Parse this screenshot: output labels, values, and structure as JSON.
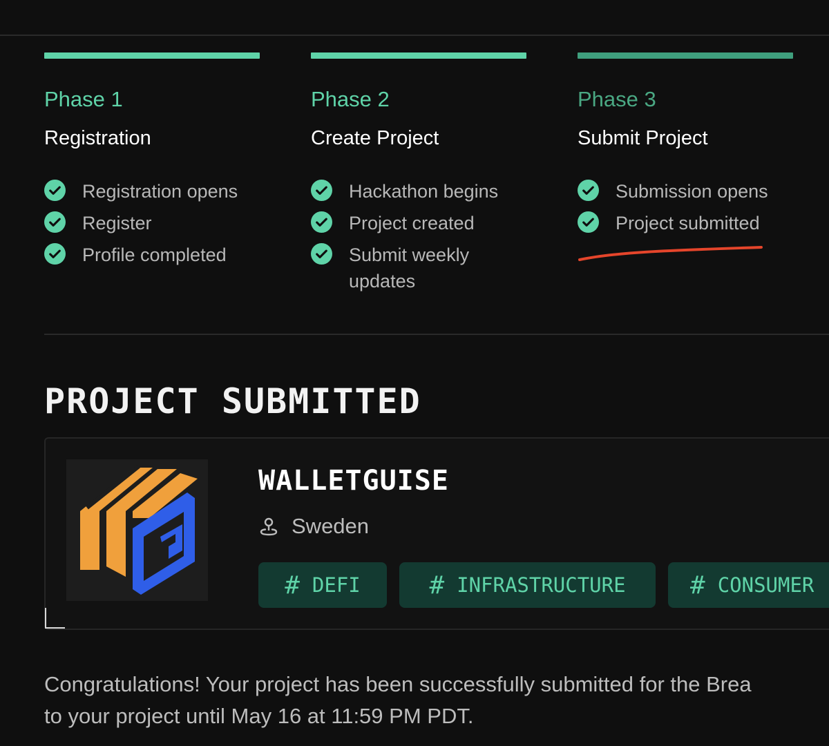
{
  "colors": {
    "accent": "#5fd3a8",
    "accent_dim": "#3f9f7d",
    "background": "#0f0f0f",
    "tag_bg": "#133a31",
    "highlight_underline": "#e5452b",
    "logo_orange": "#f0a03c",
    "logo_blue": "#2f5ee8"
  },
  "phases": [
    {
      "label": "Phase 1",
      "title": "Registration",
      "steps": [
        "Registration opens",
        "Register",
        "Profile completed"
      ]
    },
    {
      "label": "Phase 2",
      "title": "Create Project",
      "steps": [
        "Hackathon begins",
        "Project created",
        "Submit weekly updates"
      ]
    },
    {
      "label": "Phase 3",
      "title": "Submit Project",
      "steps": [
        "Submission opens",
        "Project submitted"
      ]
    }
  ],
  "section": {
    "title": "PROJECT SUBMITTED"
  },
  "project": {
    "name": "WALLETGUISE",
    "location": "Sweden",
    "location_icon": "location-pin-icon",
    "logo_icon": "walletguise-logo",
    "tags": [
      {
        "hash": "#",
        "label": "DEFI"
      },
      {
        "hash": "#",
        "label": "INFRASTRUCTURE"
      },
      {
        "hash": "#",
        "label": "CONSUMER"
      }
    ]
  },
  "message": {
    "line1": "Congratulations! Your project has been successfully submitted for the Brea",
    "line2": "to your project until May 16 at 11:59 PM PDT."
  }
}
